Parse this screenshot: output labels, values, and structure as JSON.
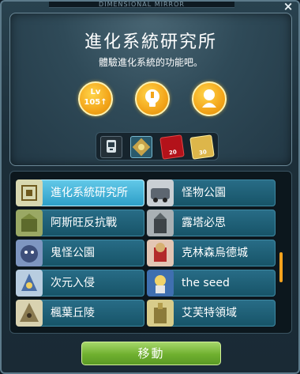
{
  "window": {
    "top_banner": "DIMENSIONAL MIRROR",
    "close_label": "×"
  },
  "header": {
    "title": "進化系統研究所",
    "subtitle": "體驗進化系統的功能吧。",
    "level_badge": {
      "top": "Lv",
      "bottom": "105↑"
    },
    "reward_icons": [
      "level-requirement-icon",
      "quest-lightbulb-icon",
      "character-silhouette-icon"
    ],
    "mini_icons": [
      {
        "icon": "device-icon",
        "label": ""
      },
      {
        "icon": "core-icon",
        "label": ""
      },
      {
        "icon": "red-ticket-icon",
        "label": "20"
      },
      {
        "icon": "gold-ticket-icon",
        "label": "30"
      }
    ]
  },
  "list": {
    "left": [
      {
        "label": "進化系統研究所",
        "icon": "research-lab-icon",
        "selected": true
      },
      {
        "label": "阿斯旺反抗戰",
        "icon": "azwan-fortress-icon"
      },
      {
        "label": "鬼怪公園",
        "icon": "monster-park-icon"
      },
      {
        "label": "次元入侵",
        "icon": "dimension-invasion-icon"
      },
      {
        "label": "楓葉丘陵",
        "icon": "maple-hill-icon"
      }
    ],
    "right": [
      {
        "label": "怪物公園",
        "icon": "monster-park-bus-icon"
      },
      {
        "label": "露塔必思",
        "icon": "root-abyss-icon"
      },
      {
        "label": "克林森烏德城",
        "icon": "crimsonwood-icon"
      },
      {
        "label": "the seed",
        "icon": "the-seed-icon"
      },
      {
        "label": "艾芙特領域",
        "icon": "elf-domain-icon"
      }
    ]
  },
  "colors": {
    "accent": "#f4a21d",
    "selected_item": "#4fb8dd",
    "item": "#1d5e75",
    "button": "#6fb02f"
  },
  "move_button": "移動"
}
